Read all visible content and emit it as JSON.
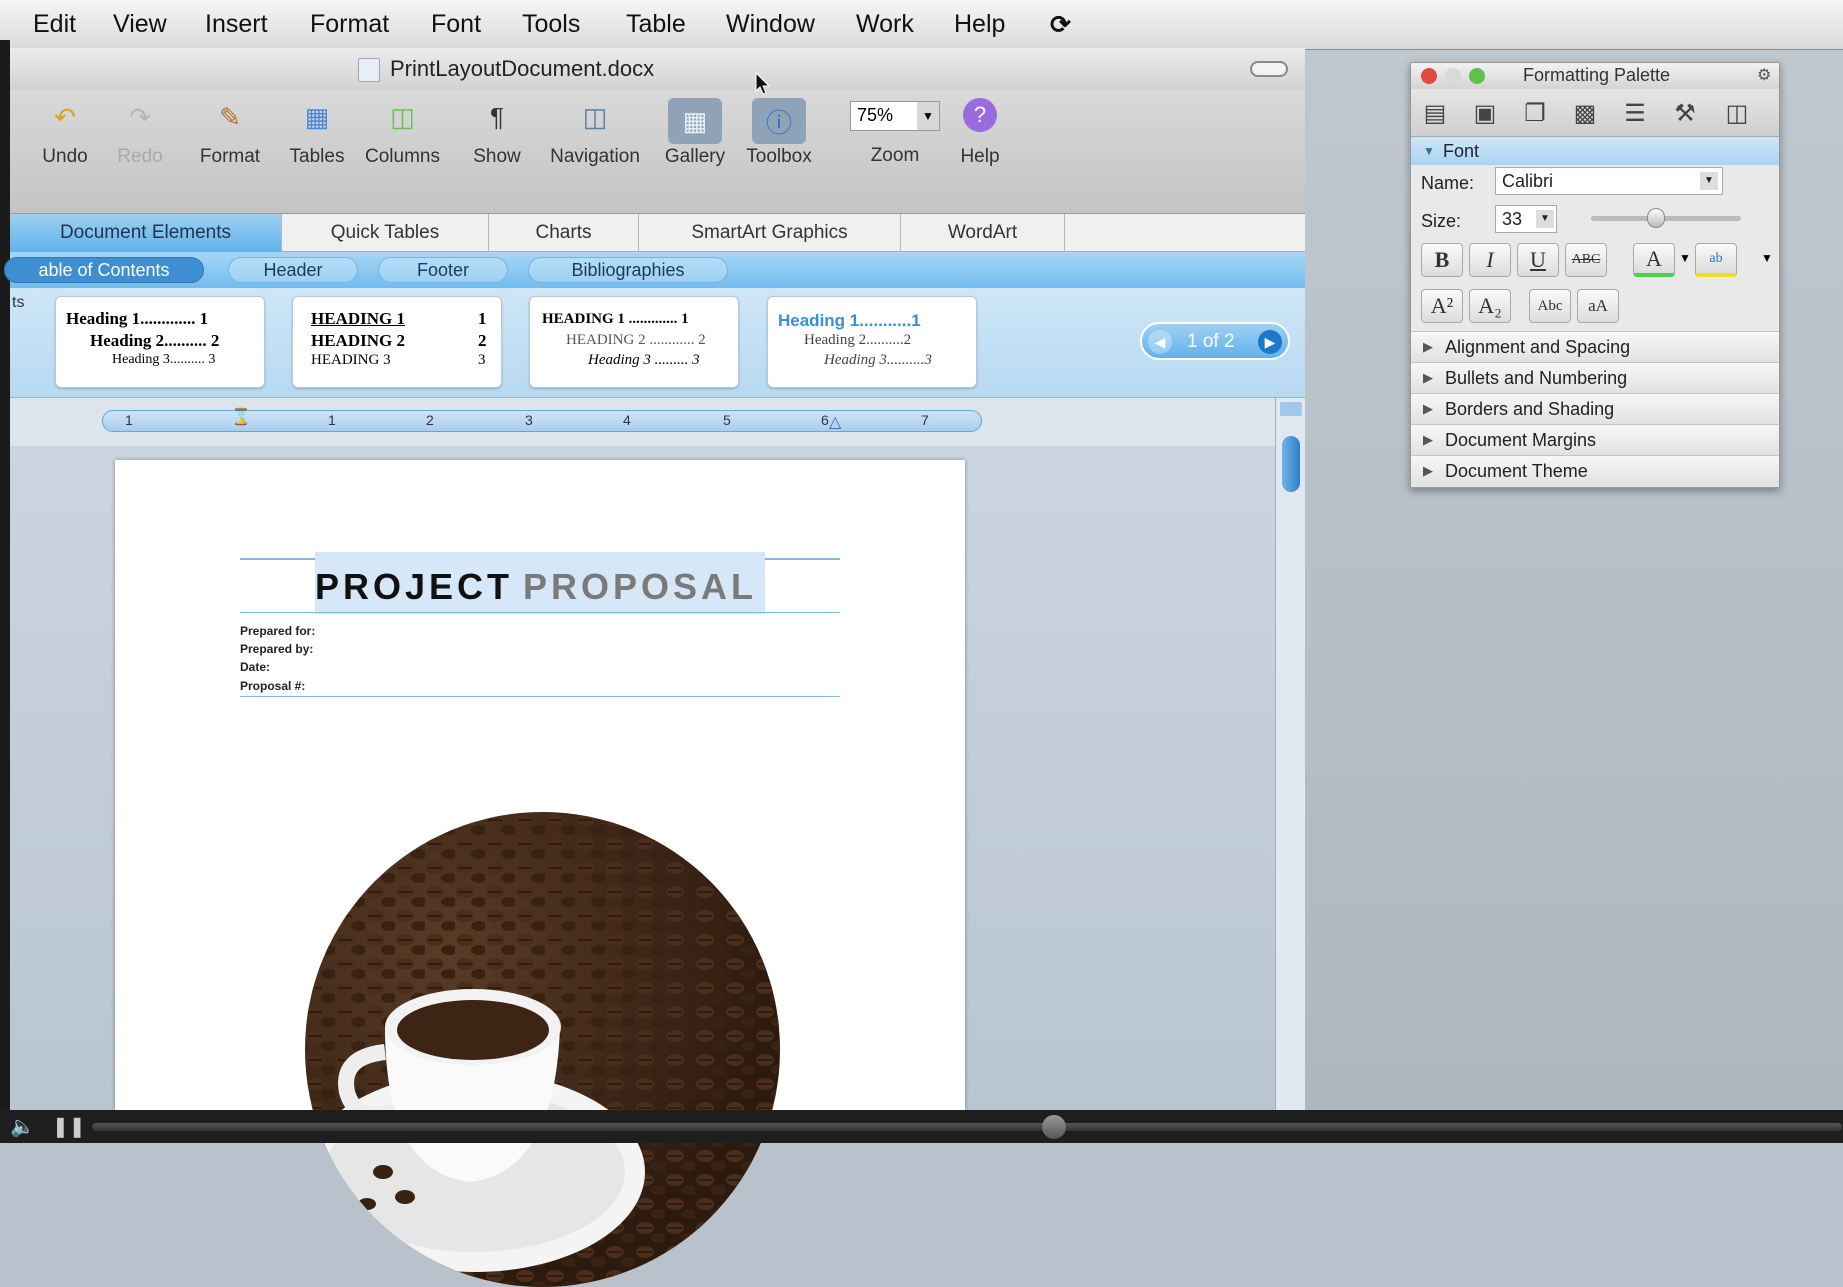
{
  "menubar": {
    "items": [
      "Edit",
      "View",
      "Insert",
      "Format",
      "Font",
      "Tools",
      "Table",
      "Window",
      "Work",
      "Help"
    ]
  },
  "window": {
    "title": "PrintLayoutDocument.docx"
  },
  "toolbar": {
    "undo": "Undo",
    "redo": "Redo",
    "format": "Format",
    "tables": "Tables",
    "columns": "Columns",
    "show": "Show",
    "navigation": "Navigation",
    "gallery": "Gallery",
    "toolbox": "Toolbox",
    "zoom": "Zoom",
    "zoom_value": "75%",
    "help": "Help"
  },
  "ribbon": {
    "tabs": [
      "Document Elements",
      "Quick Tables",
      "Charts",
      "SmartArt Graphics",
      "WordArt"
    ],
    "subtabs": [
      "able of Contents",
      "Header",
      "Footer",
      "Bibliographies"
    ],
    "side_label": "ts",
    "gallery": [
      [
        "Heading 1............. 1",
        "Heading 2.......... 2",
        "Heading 3.......... 3"
      ],
      [
        "HEADING 1",
        "1",
        "HEADING 2",
        "2",
        "HEADING 3",
        "3"
      ],
      [
        "HEADING 1 ............. 1",
        "HEADING 2 ............ 2",
        "Heading 3 ......... 3"
      ],
      [
        "Heading 1...........1",
        "Heading 2..........2",
        "Heading 3..........3"
      ]
    ],
    "pager": "1 of 2"
  },
  "ruler": {
    "marks": [
      "1",
      "1",
      "2",
      "3",
      "4",
      "5",
      "6",
      "7"
    ]
  },
  "document": {
    "title_word1": "PROJECT",
    "title_word2": "PROPOSAL",
    "fields": [
      "Prepared for:",
      "Prepared by:",
      "Date:",
      "Proposal #:"
    ]
  },
  "palette": {
    "title": "Formatting Palette",
    "font_section": "Font",
    "name_label": "Name:",
    "name_value": "Calibri",
    "size_label": "Size:",
    "size_value": "33",
    "sections": [
      "Alignment and Spacing",
      "Bullets and Numbering",
      "Borders and Shading",
      "Document Margins",
      "Document Theme"
    ]
  },
  "colors": {
    "accent": "#5fb2ea",
    "selection": "#3d8fd1"
  }
}
